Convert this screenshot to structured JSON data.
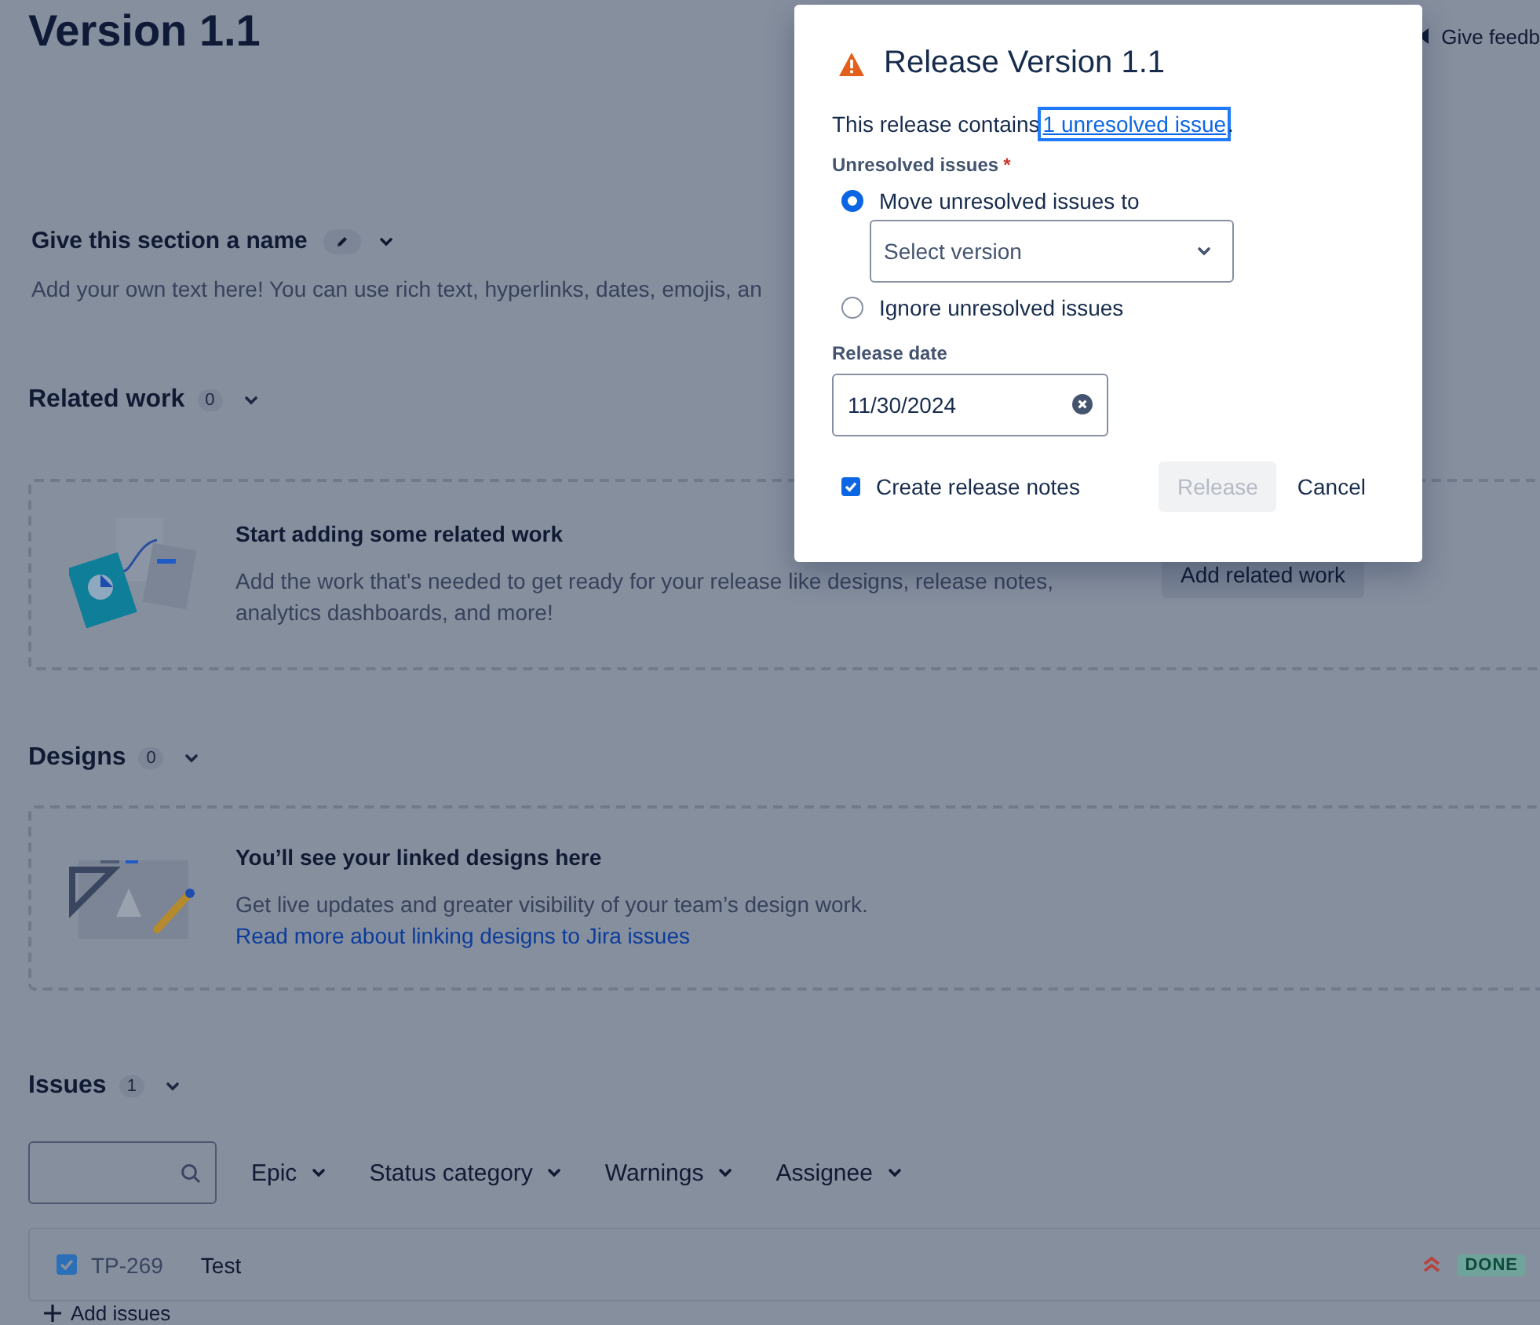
{
  "page": {
    "title": "Version 1.1",
    "feedback": "Give feedb"
  },
  "custom_section": {
    "title": "Give this section a name",
    "description": "Add your own text here! You can use rich text, hyperlinks, dates, emojis, an"
  },
  "related_work": {
    "title": "Related work",
    "count": "0",
    "empty_title": "Start adding some related work",
    "empty_text": "Add the work that's needed to get ready for your release like designs, release notes, analytics dashboards, and more!",
    "button": "Add related work"
  },
  "designs": {
    "title": "Designs",
    "count": "0",
    "empty_title": "You’ll see your linked designs here",
    "empty_text": "Get live updates and greater visibility of your team’s design work.",
    "link": "Read more about linking designs to Jira issues"
  },
  "issues": {
    "title": "Issues",
    "count": "1",
    "filters": [
      "Epic",
      "Status category",
      "Warnings",
      "Assignee"
    ],
    "rows": [
      {
        "key": "TP-269",
        "summary": "Test",
        "checked": true,
        "status": "DONE"
      }
    ],
    "add": "Add issues"
  },
  "dialog": {
    "title": "Release Version 1.1",
    "message": "This release contains",
    "link": "1 unresolved issue",
    "after_link": ".",
    "unresolved_label": "Unresolved issues",
    "required_mark": "*",
    "options": [
      {
        "label": "Move unresolved issues to",
        "selected": true
      },
      {
        "label": "Ignore unresolved issues",
        "selected": false
      }
    ],
    "version_select": {
      "placeholder": "Select version"
    },
    "date_label": "Release date",
    "date_value": "11/30/2024",
    "release_notes": {
      "label": "Create release notes",
      "checked": true
    },
    "buttons": [
      {
        "label": "Release",
        "disabled": true
      },
      {
        "label": "Cancel",
        "disabled": false
      }
    ]
  }
}
